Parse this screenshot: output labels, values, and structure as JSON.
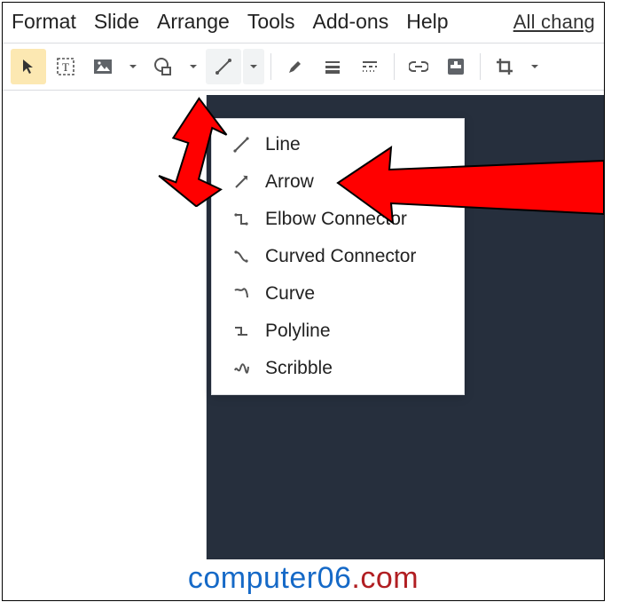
{
  "menubar": {
    "items": [
      "Format",
      "Slide",
      "Arrange",
      "Tools",
      "Add-ons",
      "Help"
    ],
    "changes_text": "All chang"
  },
  "toolbar": {
    "icons": {
      "select": "select-arrow",
      "textbox": "text-box",
      "image": "image",
      "shape": "shape",
      "line": "line",
      "pen": "pen",
      "line_weight": "line-weight",
      "line_dash": "line-dash",
      "link": "link",
      "comment": "comment",
      "crop": "crop"
    }
  },
  "line_dropdown": {
    "items": [
      {
        "label": "Line",
        "icon": "line-diag"
      },
      {
        "label": "Arrow",
        "icon": "arrow-diag"
      },
      {
        "label": "Elbow Connector",
        "icon": "elbow"
      },
      {
        "label": "Curved Connector",
        "icon": "curved-conn"
      },
      {
        "label": "Curve",
        "icon": "curve"
      },
      {
        "label": "Polyline",
        "icon": "polyline"
      },
      {
        "label": "Scribble",
        "icon": "scribble"
      }
    ]
  },
  "watermark": {
    "part1": "computer06",
    "part2": ".com"
  },
  "annotation": {
    "colors": {
      "arrow": "#ff0000",
      "arrow_stroke": "#000000"
    }
  }
}
